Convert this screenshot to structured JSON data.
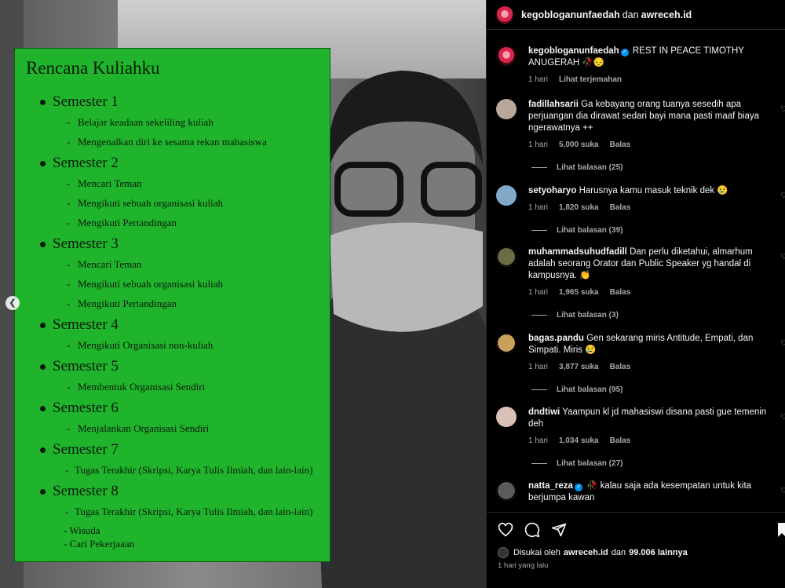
{
  "header": {
    "user1": "kegobloganunfaedah",
    "conj": "dan",
    "user2": "awreceh.id"
  },
  "slide": {
    "title": "Rencana Kuliahku",
    "semesters": [
      {
        "label": "Semester 1",
        "items": [
          "Belajar keadaan sekeliling kuliah",
          "Mengenalkan diri ke sesama rekan mahasiswa"
        ]
      },
      {
        "label": "Semester 2",
        "items": [
          "Mencari Teman",
          "Mengikuti sebuah organisasi kuliah",
          "Mengikuti Pertandingan"
        ]
      },
      {
        "label": "Semester 3",
        "items": [
          "Mencari Teman",
          "Mengikuti sebuah organisasi kuliah",
          "Mengikuti Pertandingan"
        ]
      },
      {
        "label": "Semester 4",
        "items": [
          "Mengikuti Organisasi non-kuliah"
        ]
      },
      {
        "label": "Semester 5",
        "items": [
          "Membentuk Organisasi Sendiri"
        ]
      },
      {
        "label": "Semester 6",
        "items": [
          "Menjalankan Organisasi Sendiri"
        ]
      },
      {
        "label": "Semester 7",
        "items": [
          "Tugas Terakhir (Skripsi, Karya Tulis Ilmiah, dan lain-lain)"
        ]
      },
      {
        "label": "Semester 8",
        "items": [
          "Tugas Terakhir (Skripsi, Karya Tulis Ilmiah, dan lain-lain)"
        ],
        "extra": [
          "- Wisuda",
          "- Cari Pekerjaaan"
        ]
      }
    ]
  },
  "caption": {
    "username": "kegobloganunfaedah",
    "text": "REST IN PEACE TIMOTHY ANUGERAH 🥀😔",
    "time": "1 hari",
    "translate": "Lihat terjemahan"
  },
  "comments": [
    {
      "username": "fadillahsarii",
      "verified": false,
      "text": "Ga kebayang orang tuanya sesedih apa perjuangan dia dirawat sedari bayi mana pasti maaf biaya ngerawatnya ++",
      "time": "1 hari",
      "likes": "5,000 suka",
      "reply": "Balas",
      "replies": "Lihat balasan (25)"
    },
    {
      "username": "setyoharyo",
      "verified": false,
      "text": "Harusnya kamu masuk teknik dek 😢",
      "time": "1 hari",
      "likes": "1,820 suka",
      "reply": "Balas",
      "replies": "Lihat balasan (39)"
    },
    {
      "username": "muhammadsuhudfadill",
      "verified": false,
      "text": "Dan perlu diketahui, almarhum adalah seorang Orator dan Public Speaker yg handal di kampusnya. 👏",
      "time": "1 hari",
      "likes": "1,965 suka",
      "reply": "Balas",
      "replies": "Lihat balasan (3)"
    },
    {
      "username": "bagas.pandu",
      "verified": false,
      "text": "Gen sekarang miris Antitude, Empati, dan Simpati. Miris 😢",
      "time": "1 hari",
      "likes": "3,877 suka",
      "reply": "Balas",
      "replies": "Lihat balasan (95)"
    },
    {
      "username": "dndtiwi",
      "verified": false,
      "text": "Yaampun kl jd mahasiswi disana pasti gue temenin deh",
      "time": "1 hari",
      "likes": "1,034 suka",
      "reply": "Balas",
      "replies": "Lihat balasan (27)"
    },
    {
      "username": "natta_reza",
      "verified": true,
      "text": "🥀 kalau saja ada kesempatan untuk kita berjumpa kawan",
      "time": "",
      "likes": "",
      "reply": "",
      "replies": ""
    }
  ],
  "footer": {
    "liked_by_prefix": "Disukai oleh",
    "liked_by_user": "awreceh.id",
    "liked_by_and": "dan",
    "liked_by_count": "99.006 lainnya",
    "time": "1 hari yang lalu"
  },
  "icons": [
    "heart-icon",
    "comment-icon",
    "share-icon",
    "bookmark-icon",
    "chevron-left-icon",
    "verified-icon"
  ],
  "colors": {
    "slide_green": "#1fb42c",
    "verified_blue": "#0095f6",
    "bg": "#000000"
  }
}
